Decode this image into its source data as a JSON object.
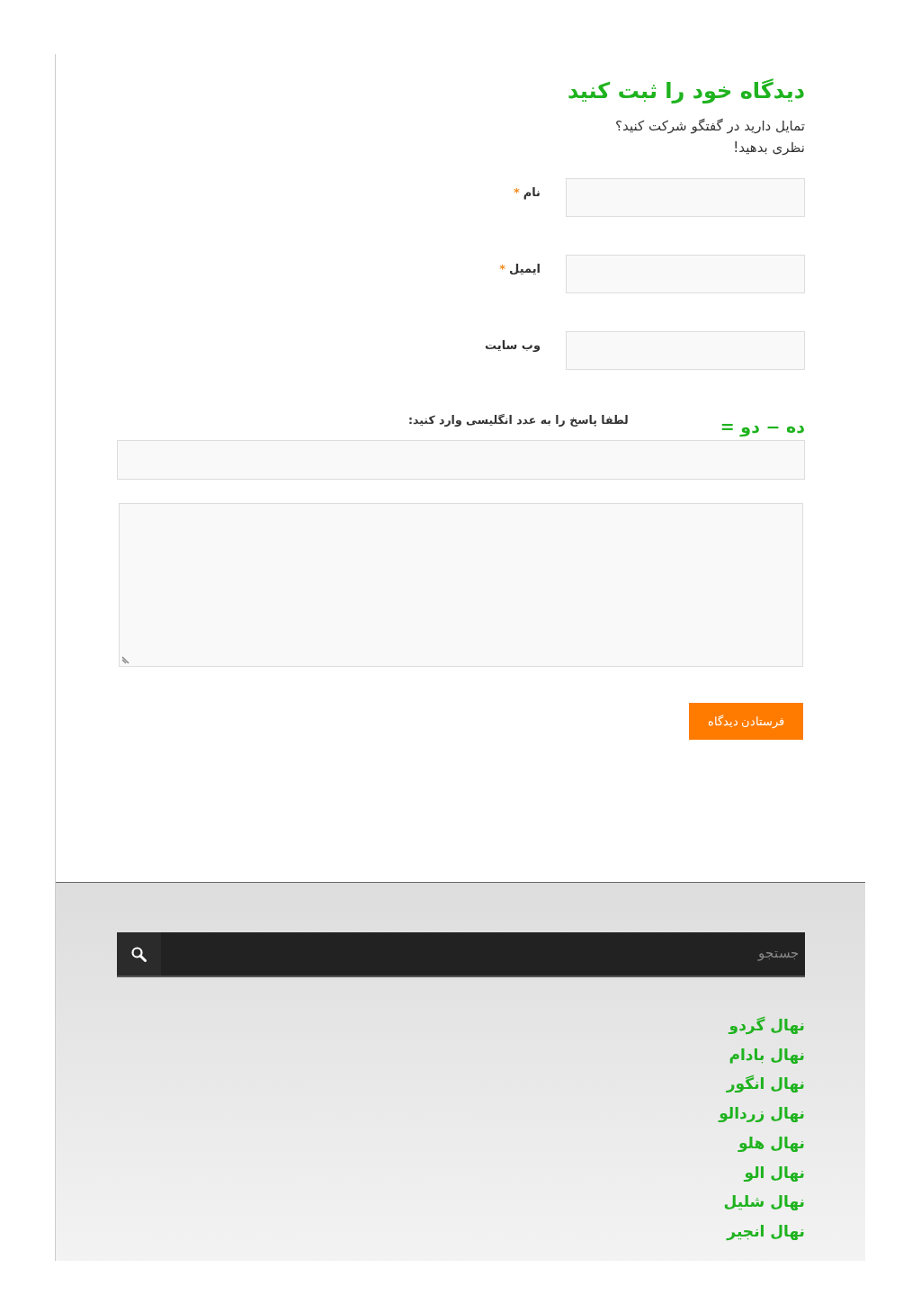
{
  "comment_form": {
    "title": "دیدگاه خود را ثبت کنید",
    "intro": [
      "تمایل دارید در گفتگو شرکت کنید؟",
      "نظری بدهید!"
    ],
    "fields": [
      {
        "label": "نام",
        "required_mark": "*"
      },
      {
        "label": "ایمیل",
        "required_mark": "*"
      },
      {
        "label": "وب سایت"
      }
    ],
    "captcha": {
      "prompt": "لطفا پاسخ را به عدد انگلیسی وارد کنید:",
      "question": "ده − دو ="
    },
    "submit": "فرستادن دیدگاه"
  },
  "footer": {
    "search": {
      "placeholder": "جستجو"
    },
    "links": [
      "نهال گردو",
      "نهال بادام",
      "نهال انگور",
      "نهال زردالو",
      "نهال هلو",
      "نهال الو",
      "نهال شلیل",
      "نهال انجیر"
    ]
  }
}
